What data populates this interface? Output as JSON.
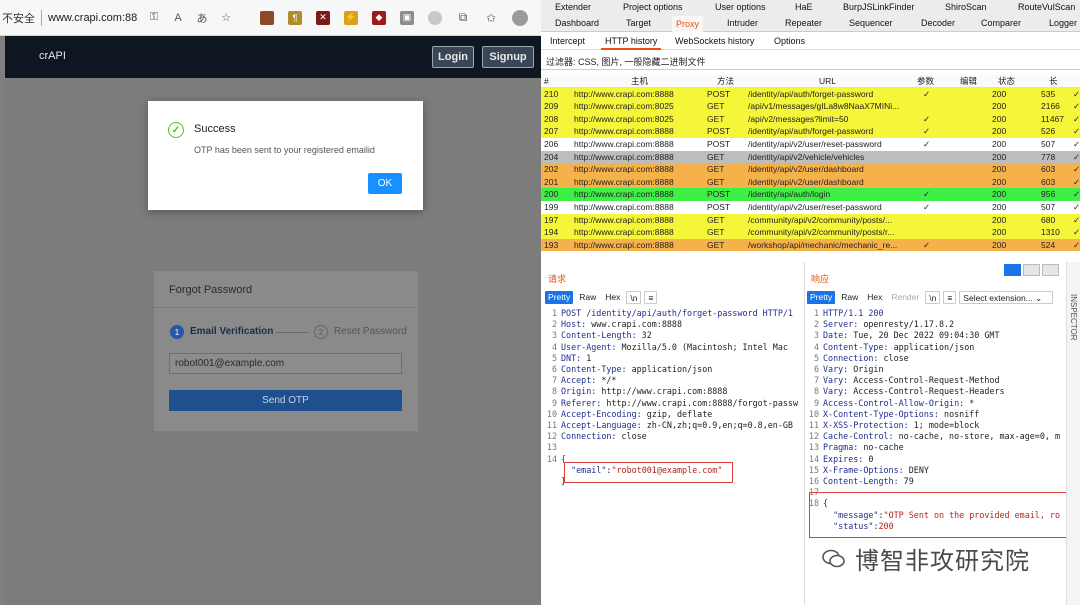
{
  "browser": {
    "security_label": "不安全",
    "url": "www.crapi.com:88...",
    "brand": "crAPI",
    "login_label": "Login",
    "signup_label": "Signup",
    "modal": {
      "title": "Success",
      "message": "OTP has been sent to your registered emailid",
      "ok_label": "OK"
    },
    "forgot": {
      "title": "Forgot Password",
      "step1_num": "1",
      "step1_label": "Email Verification",
      "step2_num": "2",
      "step2_label": "Reset Password",
      "email_value": "robot001@example.com",
      "send_label": "Send OTP"
    },
    "ext_icons": [
      "ext-1",
      "ext-2",
      "ext-3",
      "ext-4",
      "ext-5",
      "ext-6",
      "ext-7",
      "ext-8",
      "ext-9"
    ]
  },
  "burp": {
    "top_tabs_row1": [
      "Extender",
      "Project options",
      "User options",
      "HaE",
      "BurpJSLinkFinder",
      "ShiroScan",
      "RouteVulScan"
    ],
    "top_tabs_row2": [
      "Dashboard",
      "Target",
      "Proxy",
      "Intruder",
      "Repeater",
      "Sequencer",
      "Decoder",
      "Comparer",
      "Logger"
    ],
    "selected_tab": "Proxy",
    "proxy_tabs": [
      "Intercept",
      "HTTP history",
      "WebSockets history",
      "Options"
    ],
    "selected_proxy_tab": "HTTP history",
    "filter": "过滤器: CSS, 图片, 一般隐藏二进制文件",
    "columns": {
      "num": "#",
      "host": "主机",
      "method": "方法",
      "url": "URL",
      "params": "参数",
      "edited": "编辑",
      "status": "状态",
      "length": "长"
    },
    "rows": [
      {
        "num": "210",
        "host": "http://www.crapi.com:8888",
        "method": "POST",
        "url": "/identity/api/auth/forget-password",
        "params": "✓",
        "status": "200",
        "length": "535",
        "color": "#f5f53a"
      },
      {
        "num": "209",
        "host": "http://www.crapi.com:8025",
        "method": "GET",
        "url": "/api/v1/messages/gILa8w8NaaX7MINi...",
        "params": "",
        "status": "200",
        "length": "2166",
        "color": "#f5f53a"
      },
      {
        "num": "208",
        "host": "http://www.crapi.com:8025",
        "method": "GET",
        "url": "/api/v2/messages?limit=50",
        "params": "✓",
        "status": "200",
        "length": "11467",
        "color": "#f5f53a"
      },
      {
        "num": "207",
        "host": "http://www.crapi.com:8888",
        "method": "POST",
        "url": "/identity/api/auth/forget-password",
        "params": "✓",
        "status": "200",
        "length": "526",
        "color": "#f5f53a"
      },
      {
        "num": "206",
        "host": "http://www.crapi.com:8888",
        "method": "POST",
        "url": "/identity/api/v2/user/reset-password",
        "params": "✓",
        "status": "200",
        "length": "507",
        "color": "#ffffff"
      },
      {
        "num": "204",
        "host": "http://www.crapi.com:8888",
        "method": "GET",
        "url": "/identity/api/v2/vehicle/vehicles",
        "params": "",
        "status": "200",
        "length": "778",
        "color": "#bdbdbd"
      },
      {
        "num": "202",
        "host": "http://www.crapi.com:8888",
        "method": "GET",
        "url": "/identity/api/v2/user/dashboard",
        "params": "",
        "status": "200",
        "length": "603",
        "color": "#f6b24a"
      },
      {
        "num": "201",
        "host": "http://www.crapi.com:8888",
        "method": "GET",
        "url": "/identity/api/v2/user/dashboard",
        "params": "",
        "status": "200",
        "length": "603",
        "color": "#f6b24a"
      },
      {
        "num": "200",
        "host": "http://www.crapi.com:8888",
        "method": "POST",
        "url": "/identity/api/auth/login",
        "params": "✓",
        "status": "200",
        "length": "956",
        "color": "#3ef046"
      },
      {
        "num": "199",
        "host": "http://www.crapi.com:8888",
        "method": "POST",
        "url": "/identity/api/v2/user/reset-password",
        "params": "✓",
        "status": "200",
        "length": "507",
        "color": "#ffffff"
      },
      {
        "num": "197",
        "host": "http://www.crapi.com:8888",
        "method": "GET",
        "url": "/community/api/v2/community/posts/...",
        "params": "",
        "status": "200",
        "length": "680",
        "color": "#f5f53a"
      },
      {
        "num": "194",
        "host": "http://www.crapi.com:8888",
        "method": "GET",
        "url": "/community/api/v2/community/posts/r...",
        "params": "",
        "status": "200",
        "length": "1310",
        "color": "#f5f53a"
      },
      {
        "num": "193",
        "host": "http://www.crapi.com:8888",
        "method": "GET",
        "url": "/workshop/api/mechanic/mechanic_re...",
        "params": "✓",
        "status": "200",
        "length": "524",
        "color": "#f6b24a"
      }
    ],
    "request": {
      "header": "请求",
      "buttons": [
        "Pretty",
        "Raw",
        "Hex",
        "\\n",
        "≡"
      ],
      "lines": [
        {
          "n": "1",
          "k": "POST /identity/api/auth/forget-password HTTP/1",
          "v": ""
        },
        {
          "n": "2",
          "k": "Host:",
          "v": " www.crapi.com:8888"
        },
        {
          "n": "3",
          "k": "Content-Length:",
          "v": " 32"
        },
        {
          "n": "4",
          "k": "User-Agent:",
          "v": " Mozilla/5.0 (Macintosh; Intel Mac "
        },
        {
          "n": "5",
          "k": "DNT:",
          "v": " 1"
        },
        {
          "n": "6",
          "k": "Content-Type:",
          "v": " application/json"
        },
        {
          "n": "7",
          "k": "Accept:",
          "v": " */*"
        },
        {
          "n": "8",
          "k": "Origin:",
          "v": " http://www.crapi.com:8888"
        },
        {
          "n": "9",
          "k": "Referer:",
          "v": " http://www.crapi.com:8888/forgot-passw"
        },
        {
          "n": "10",
          "k": "Accept-Encoding:",
          "v": " gzip, deflate"
        },
        {
          "n": "11",
          "k": "Accept-Language:",
          "v": " zh-CN,zh;q=0.9,en;q=0.8,en-GB"
        },
        {
          "n": "12",
          "k": "Connection:",
          "v": " close"
        },
        {
          "n": "13",
          "k": "",
          "v": ""
        },
        {
          "n": "14",
          "k": "{",
          "v": ""
        }
      ],
      "body_key": "\"email\"",
      "body_sep": ":",
      "body_value": "\"robot001@example.com\"",
      "close_brace": "}"
    },
    "response": {
      "header": "响应",
      "buttons": [
        "Pretty",
        "Raw",
        "Hex",
        "Render",
        "\\n",
        "≡",
        "Select extension... ⌄"
      ],
      "lines": [
        {
          "n": "1",
          "k": "HTTP/1.1 200",
          "v": ""
        },
        {
          "n": "2",
          "k": "Server:",
          "v": " openresty/1.17.8.2"
        },
        {
          "n": "3",
          "k": "Date:",
          "v": " Tue, 20 Dec 2022 09:04:30 GMT"
        },
        {
          "n": "4",
          "k": "Content-Type:",
          "v": " application/json"
        },
        {
          "n": "5",
          "k": "Connection:",
          "v": " close"
        },
        {
          "n": "6",
          "k": "Vary:",
          "v": " Origin"
        },
        {
          "n": "7",
          "k": "Vary:",
          "v": " Access-Control-Request-Method"
        },
        {
          "n": "8",
          "k": "Vary:",
          "v": " Access-Control-Request-Headers"
        },
        {
          "n": "9",
          "k": "Access-Control-Allow-Origin:",
          "v": " *"
        },
        {
          "n": "10",
          "k": "X-Content-Type-Options:",
          "v": " nosniff"
        },
        {
          "n": "11",
          "k": "X-XSS-Protection:",
          "v": " 1; mode=block"
        },
        {
          "n": "12",
          "k": "Cache-Control:",
          "v": " no-cache, no-store, max-age=0, m"
        },
        {
          "n": "13",
          "k": "Pragma:",
          "v": " no-cache"
        },
        {
          "n": "14",
          "k": "Expires:",
          "v": " 0"
        },
        {
          "n": "15",
          "k": "X-Frame-Options:",
          "v": " DENY"
        },
        {
          "n": "16",
          "k": "Content-Length:",
          "v": " 79"
        },
        {
          "n": "17",
          "k": "",
          "v": ""
        },
        {
          "n": "18",
          "k": "{",
          "v": ""
        }
      ],
      "msg_key": "\"message\"",
      "msg_value": "\"OTP Sent on the provided email, ro",
      "status_key": "\"status\"",
      "status_value": "200"
    },
    "inspector_label": "INSPECTOR",
    "watermark": "博智非攻研究院"
  }
}
